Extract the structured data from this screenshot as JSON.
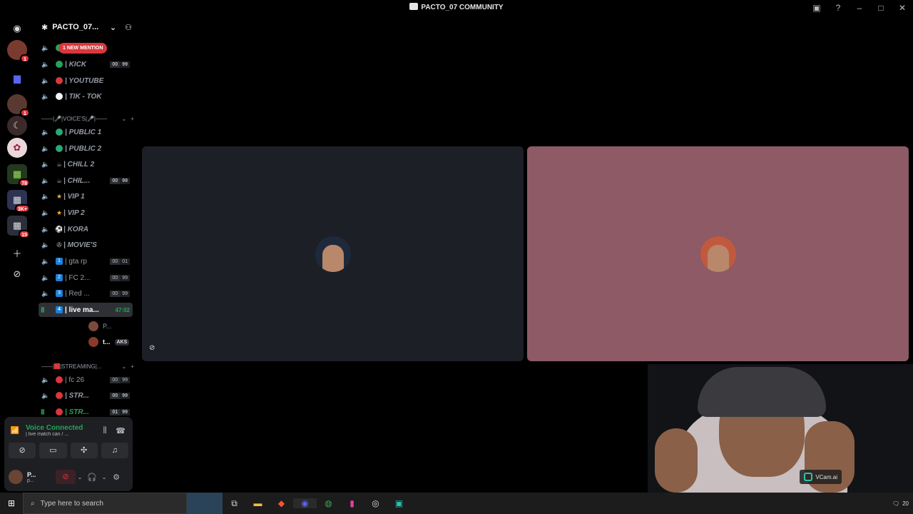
{
  "window": {
    "title": "PACTO_07 COMMUNITY"
  },
  "guild_badges": {
    "g1": "1",
    "g3": "1",
    "g7": "78",
    "g8": "3K+",
    "g9": "15"
  },
  "server": {
    "name": "PACTO_07..."
  },
  "mention_pill": "1 NEW MENTION",
  "channels": {
    "kick": {
      "name": "| KICK",
      "count_a": "00",
      "count_b": "99"
    },
    "youtube": {
      "name": "| YOUTUBE"
    },
    "tiktok": {
      "name": "| TIK - TOK"
    },
    "cat_voices": "VOICE'S",
    "public1": {
      "name": "| PUBLIC 1"
    },
    "public2": {
      "name": "| PUBLIC 2"
    },
    "chill2": {
      "name": "| CHILL 2"
    },
    "chill": {
      "name": "| CHIL...",
      "count_a": "00",
      "count_b": "99"
    },
    "vip1": {
      "name": "| VIP 1"
    },
    "vip2": {
      "name": "| VIP 2"
    },
    "kora": {
      "name": "| KORA"
    },
    "movies": {
      "name": "| MOVIE'S"
    },
    "gtarp": {
      "name": "| gta rp",
      "num": "1",
      "count_a": "00",
      "count_b": "01"
    },
    "fc2": {
      "name": "| FC 2...",
      "num": "2",
      "count_a": "00",
      "count_b": "99"
    },
    "red": {
      "name": "| Red ...",
      "num": "3",
      "count_a": "00",
      "count_b": "99"
    },
    "live": {
      "name": "| live ma...",
      "num": "4",
      "timer": "47:02"
    },
    "voice_user_1": "P...",
    "voice_user_2": "t...",
    "aks_tag": "AKS",
    "cat_streaming": "STREAMING|...",
    "fc26": {
      "name": "| fc 26",
      "count_a": "00",
      "count_b": "99"
    },
    "str1": {
      "name": "| STR...",
      "count_a": "00",
      "count_b": "99"
    },
    "str2": {
      "name": "| STR...",
      "count_a": "01",
      "count_b": "99"
    }
  },
  "voice_panel": {
    "status": "Voice Connected",
    "channel": "| live match can / ...",
    "user_name": "P...",
    "user_status": "p..."
  },
  "watermark": "VCam.ai",
  "taskbar": {
    "search_placeholder": "Type here to search",
    "notif_count": "20"
  },
  "colors": {
    "discord_green": "#23a559",
    "mention_red": "#da373c",
    "tile_left": "#1d1f27",
    "tile_right": "#8d5a66"
  }
}
